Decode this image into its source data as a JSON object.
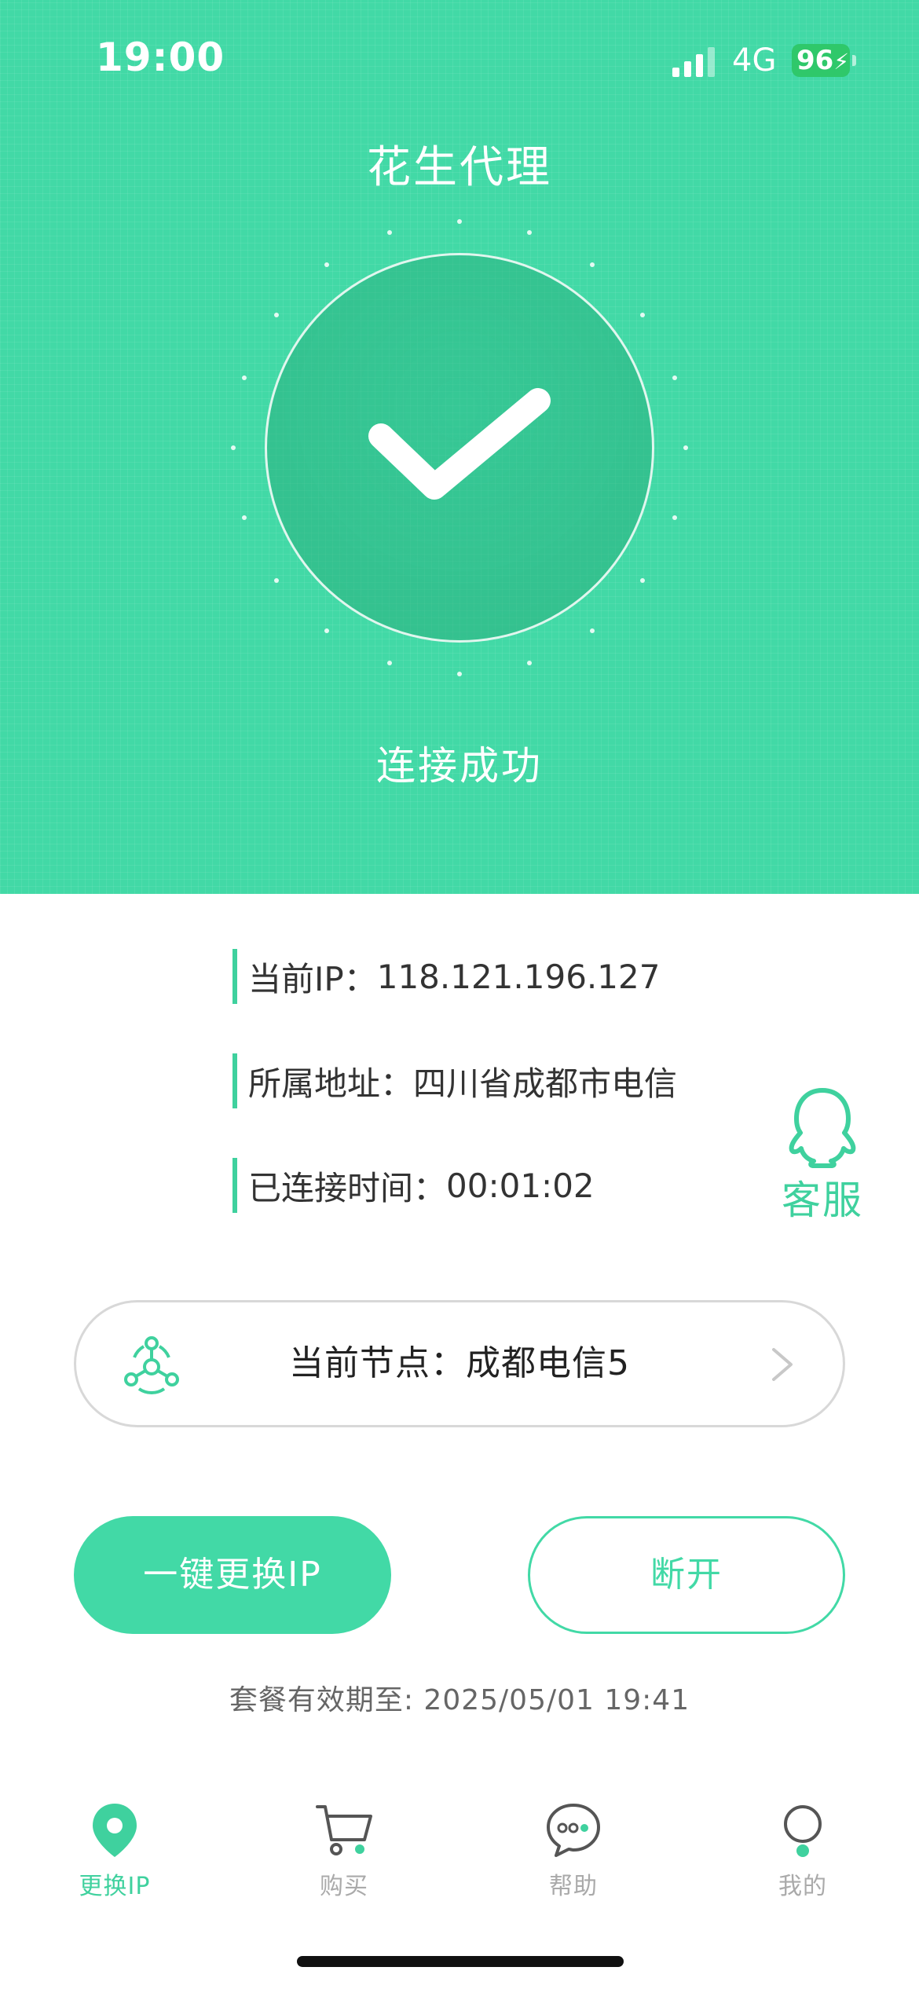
{
  "status_bar": {
    "time": "19:00",
    "network": "4G",
    "battery": "96"
  },
  "app": {
    "title": "花生代理",
    "connection_status": "连接成功"
  },
  "info": {
    "ip_label": "当前IP：",
    "ip_value": "118.121.196.127",
    "address_label": "所属地址：",
    "address_value": "四川省成都市电信",
    "time_label": "已连接时间：",
    "time_value": "00:01:02"
  },
  "service": {
    "label": "客服",
    "icon": "qq-penguin-icon"
  },
  "node": {
    "label": "当前节点：成都电信5",
    "icon": "node-network-icon"
  },
  "buttons": {
    "change_ip": "一键更换IP",
    "disconnect": "断开"
  },
  "expiry": "套餐有效期至: 2025/05/01 19:41",
  "tabs": [
    {
      "label": "更换IP",
      "icon": "location-pin-icon",
      "active": true
    },
    {
      "label": "购买",
      "icon": "cart-icon",
      "active": false
    },
    {
      "label": "帮助",
      "icon": "chat-bubble-icon",
      "active": false
    },
    {
      "label": "我的",
      "icon": "profile-icon",
      "active": false
    }
  ],
  "colors": {
    "accent": "#42d9a6",
    "battery": "#2fc86a"
  }
}
